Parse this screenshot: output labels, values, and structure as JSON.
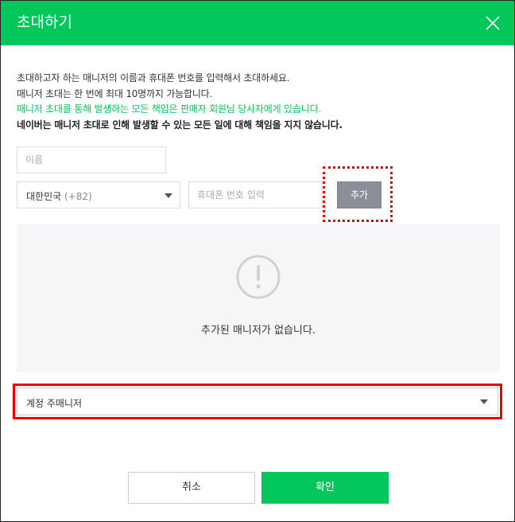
{
  "dialog": {
    "title": "초대하기",
    "close_icon": "close-icon"
  },
  "description": {
    "line1": "초대하고자 하는 매니저의 이름과 휴대폰 번호를 입력해서 초대하세요.",
    "line2": "매니저 초대는 한 번에 최대 10명까지 가능합니다.",
    "line3": "매니저 초대를 통해 발생하는 모든 책임은 판매자 회원님 당사자에게 있습니다.",
    "line4": "네이버는 매니저 초대로 인해 발생할 수 있는 모든 일에 대해 책임을 지지 않습니다."
  },
  "form": {
    "name_placeholder": "이름",
    "country_label": "대한민국",
    "country_code": "(+82)",
    "phone_placeholder": "휴대폰 번호 입력",
    "add_label": "추가"
  },
  "empty_state": {
    "icon": "exclamation-circle-icon",
    "message": "추가된 매니저가 없습니다."
  },
  "role_select": {
    "value": "계정 주매니저"
  },
  "footer": {
    "cancel_label": "취소",
    "confirm_label": "확인"
  },
  "colors": {
    "brand_green": "#03c75a",
    "highlight_red": "#ee0000",
    "add_button_gray": "#8a8f99",
    "empty_bg": "#f5f6f8"
  }
}
